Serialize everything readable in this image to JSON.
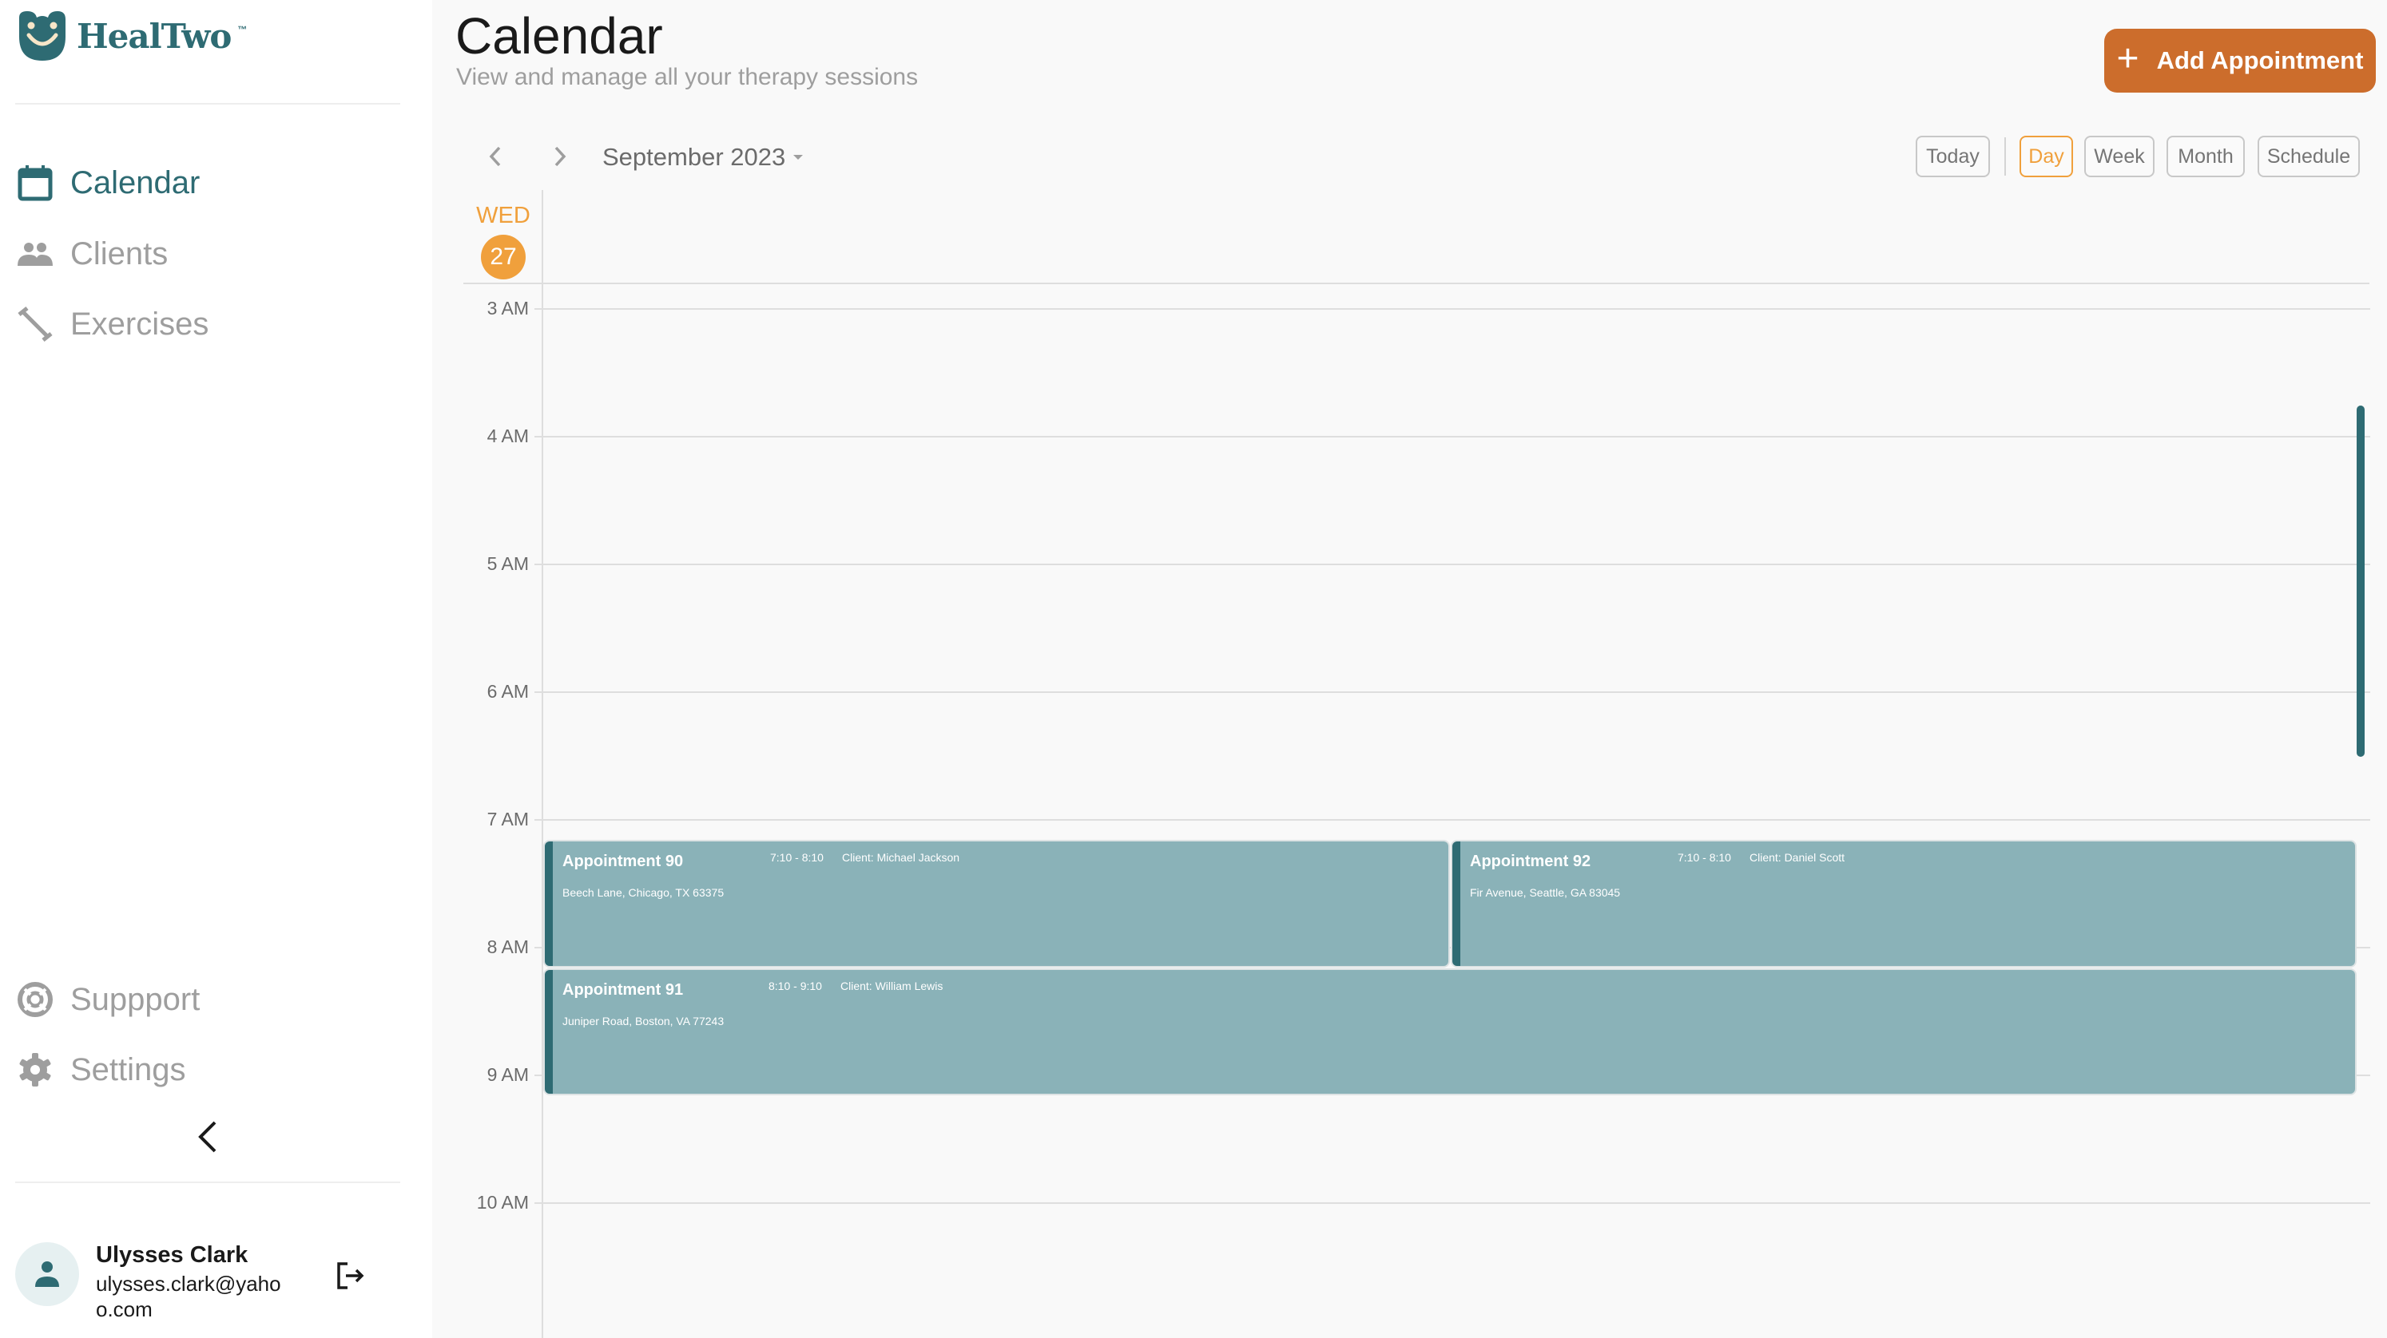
{
  "brand": {
    "name": "HealTwo",
    "trademark": "™",
    "color": "#2e6b73"
  },
  "sidebar": {
    "nav_items": [
      {
        "label": "Calendar",
        "icon": "calendar-icon",
        "active": true
      },
      {
        "label": "Clients",
        "icon": "people-icon",
        "active": false
      },
      {
        "label": "Exercises",
        "icon": "dumbbell-icon",
        "active": false
      }
    ],
    "bottom_items": [
      {
        "label": "Suppport",
        "icon": "support-icon"
      },
      {
        "label": "Settings",
        "icon": "gear-icon"
      }
    ],
    "collapse_icon": "chevron-left-icon",
    "user": {
      "name": "Ulysses Clark",
      "email": "ulysses.clark@yahoo.com",
      "logout_icon": "logout-icon"
    }
  },
  "header": {
    "title": "Calendar",
    "subtitle": "View and manage all your therapy sessions",
    "add_button": {
      "label": "Add Appointment",
      "icon": "plus-icon",
      "color": "#cc6d2c"
    }
  },
  "toolbar": {
    "prev_icon": "chevron-left-icon",
    "next_icon": "chevron-right-icon",
    "month_label": "September 2023",
    "today_label": "Today",
    "views": [
      {
        "label": "Day",
        "active": true
      },
      {
        "label": "Week",
        "active": false
      },
      {
        "label": "Month",
        "active": false
      },
      {
        "label": "Schedule",
        "active": false
      }
    ],
    "accent_color": "#f0a03c"
  },
  "day_view": {
    "weekday": "WED",
    "day": "27",
    "hours": [
      "3 AM",
      "4 AM",
      "5 AM",
      "6 AM",
      "7 AM",
      "8 AM",
      "9 AM",
      "10 AM"
    ],
    "appointments": [
      {
        "title": "Appointment 90",
        "time": "7:10 - 8:10",
        "client": "Client: Michael Jackson",
        "address": "Beech Lane, Chicago, TX 63375"
      },
      {
        "title": "Appointment 92",
        "time": "7:10 - 8:10",
        "client": "Client: Daniel Scott",
        "address": "Fir Avenue, Seattle, GA 83045"
      },
      {
        "title": "Appointment 91",
        "time": "8:10 - 9:10",
        "client": "Client: William Lewis",
        "address": "Juniper Road, Boston, VA 77243"
      }
    ],
    "appointment_color": "#8ab2b8"
  }
}
